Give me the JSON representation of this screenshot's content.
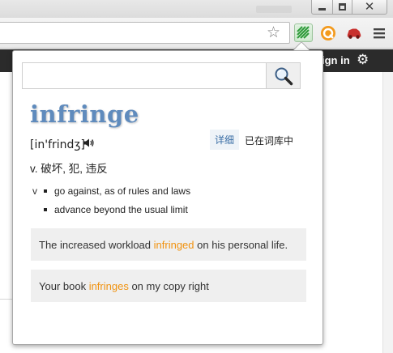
{
  "dictionary": {
    "headword": "infringe",
    "phonetic": "[in'frindʒ]",
    "detail_link": "详细",
    "wordbook_status": "已在词库中",
    "translation": "v. 破坏, 犯, 违反",
    "senses_pos": "v",
    "senses": [
      "go against, as of rules and laws",
      "advance beyond the usual limit"
    ],
    "examples": [
      {
        "before": "The increased workload ",
        "highlight": "infringed",
        "after": " on his personal life."
      },
      {
        "before": "Your book ",
        "highlight": "infringes",
        "after": " on my copy right"
      }
    ],
    "search_value": ""
  },
  "page": {
    "signin_label": "ign in"
  },
  "icons": {
    "search": "magnifier-icon",
    "speaker": "speaker-icon",
    "settings": "gear-icon",
    "bookmark": "star-icon",
    "menu": "hamburger-menu-icon"
  },
  "colors": {
    "headword": "#5f8bbd",
    "highlight": "#f0920f",
    "detail_bg": "#eef3f8"
  }
}
